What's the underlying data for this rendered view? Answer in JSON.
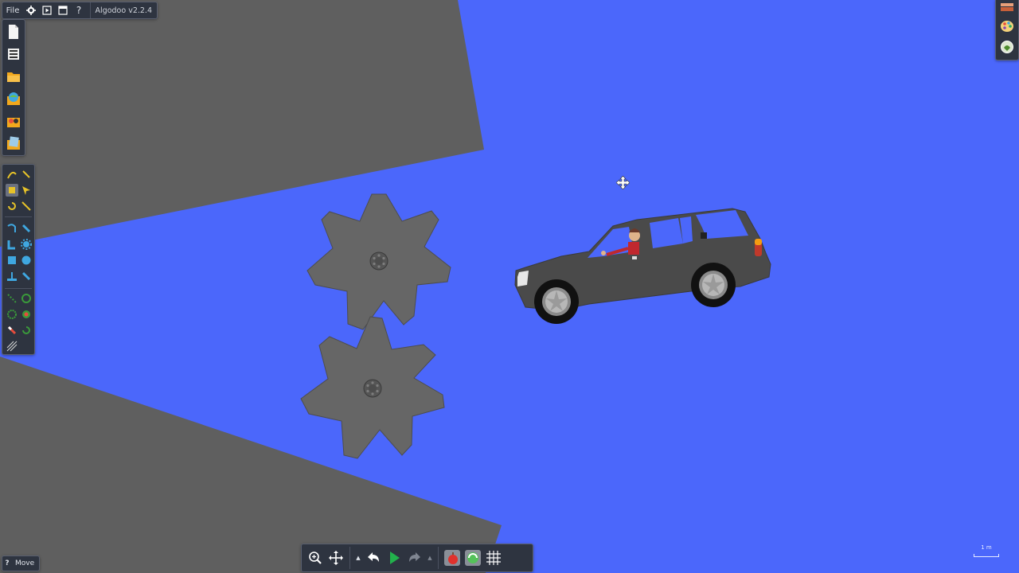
{
  "app": {
    "title": "Algodoo v2.2.4"
  },
  "menu": {
    "file_label": "File",
    "help_glyph": "?"
  },
  "status": {
    "help_glyph": "?",
    "mode_label": "Move"
  },
  "scale": {
    "label": "1 m"
  },
  "colors": {
    "background": "#4b67fb",
    "plane": "#5f5f5f",
    "gear": "#666666",
    "car_body": "#4a4a4a",
    "panel": "#2e3440",
    "play": "#22b14c"
  },
  "icons": {
    "menu": [
      "gear-icon",
      "play-window-icon",
      "window-icon",
      "help-icon"
    ],
    "file_tools": [
      "new-scene-icon",
      "save-icon",
      "open-folder-icon",
      "scene-browser-icon",
      "phunlet-icon",
      "notes-icon"
    ],
    "tools": [
      "sketch-icon",
      "brush-icon",
      "move-icon",
      "drag-icon",
      "rotate-icon",
      "scale-icon",
      "rope-icon",
      "spring-icon",
      "fixate-icon",
      "gear-tool-icon",
      "box-icon",
      "circle-icon",
      "plane-icon",
      "laser-icon",
      "chain-icon",
      "axle-icon",
      "thruster-icon",
      "tracer-icon",
      "eraser-icon",
      "cut-icon",
      "brush-lines-icon"
    ],
    "right": [
      "layers-icon",
      "palette-icon",
      "background-icon"
    ],
    "playback": [
      "zoom-icon",
      "pan-icon",
      "undo-icon",
      "play-icon",
      "redo-icon",
      "gravity-icon",
      "air-icon",
      "grid-icon"
    ]
  },
  "playback": {
    "state": "paused"
  }
}
